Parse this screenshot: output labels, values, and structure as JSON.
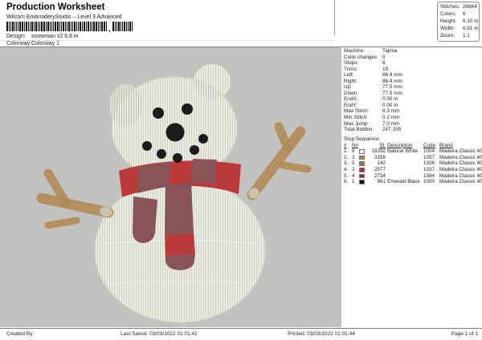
{
  "header": {
    "title": "Production Worksheet",
    "subtitle": "Wilcom EmbroideryStudio – Level 3 Advanced",
    "design_label": "Design:",
    "design_value": "snowman v2 6,8 in",
    "colorway_label": "Colorway:",
    "colorway_value": "Colorway 1",
    "barcode_left": "2112111221211212112212111221121121121121212112211221",
    "barcode_separator": ",",
    "barcode_right": "21121121121"
  },
  "summary_box": {
    "rows": [
      {
        "label": "Stitches:",
        "value": "28864"
      },
      {
        "label": "Colors:",
        "value": "6"
      },
      {
        "label": "Height:",
        "value": "6.10 in"
      },
      {
        "label": "Width:",
        "value": "6.81 in"
      },
      {
        "label": "Zoom:",
        "value": "1:1"
      }
    ]
  },
  "machine_info": {
    "rows": [
      {
        "label": "Machine:",
        "value": "Tajima"
      },
      {
        "label": "Color changes:",
        "value": "5"
      },
      {
        "label": "Stops:",
        "value": "6"
      },
      {
        "label": "Trims:",
        "value": "19"
      },
      {
        "label": "Left:",
        "value": "86.4 mm"
      },
      {
        "label": "Right:",
        "value": "86.4 mm"
      },
      {
        "label": "Up:",
        "value": "77.5 mm"
      },
      {
        "label": "Down:",
        "value": "77.5 mm"
      },
      {
        "label": "EndX:",
        "value": "0.00 in"
      },
      {
        "label": "EndY:",
        "value": "0.00 in"
      },
      {
        "label": "Max Stitch:",
        "value": "8.3 mm"
      },
      {
        "label": "Min Stitch:",
        "value": "0.2 mm"
      },
      {
        "label": "Max Jump:",
        "value": "7.0 mm"
      },
      {
        "label": "Total Bobbin:",
        "value": "247.10ft"
      }
    ]
  },
  "stop_sequence": {
    "title": "Stop Sequence:",
    "columns": [
      "#",
      "N#",
      "St.",
      "Description",
      "Code",
      "Brand"
    ],
    "rows": [
      {
        "num": "1.",
        "needle": "6",
        "swatch": "#ededе3",
        "swatch_color": "#edede3",
        "stitches": "19292",
        "description": "Natural White",
        "code": "1004",
        "brand": "Madeira Classic 40"
      },
      {
        "num": "2.",
        "needle": "3",
        "swatch_color": "#b2854f",
        "stitches": "3156",
        "description": "",
        "code": "1057",
        "brand": "Madeira Classic 40"
      },
      {
        "num": "3.",
        "needle": "5",
        "swatch_color": "#8a7158",
        "stitches": "142",
        "description": "",
        "code": "1336",
        "brand": "Madeira Classic 40"
      },
      {
        "num": "4.",
        "needle": "2",
        "swatch_color": "#c1272d",
        "stitches": "2577",
        "description": "",
        "code": "1037",
        "brand": "Madeira Classic 40"
      },
      {
        "num": "5.",
        "needle": "4",
        "swatch_color": "#7c3b43",
        "stitches": "2734",
        "description": "",
        "code": "1384",
        "brand": "Madeira Classic 40"
      },
      {
        "num": "6.",
        "needle": "1",
        "swatch_color": "#141414",
        "stitches": "961",
        "description": "Emerald Black",
        "code": "1000",
        "brand": "Madeira Classic 40"
      }
    ]
  },
  "footer": {
    "created": "Created By:",
    "last_saved": "Last Saved: 03/03/2022 01:01:42",
    "printed": "Printed: 03/03/2022 01:01:44",
    "page": "Page 1 of 1"
  },
  "design": {
    "canvas_bg": "#c2c2c0",
    "snow": "#ebece1",
    "snow_edge": "#d8dbca",
    "ear_shade": "#dce0d0",
    "scarf_red": "#c33c3c",
    "scarf_maroon": "#8e575c",
    "stick": "#bd9765",
    "stick_cap": "#cbc2ae",
    "dot_black": "#1b1b1b"
  }
}
